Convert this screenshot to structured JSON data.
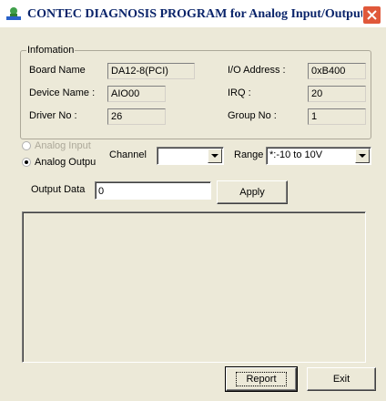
{
  "window": {
    "title": "CONTEC DIAGNOSIS PROGRAM for Analog Input/Output"
  },
  "info": {
    "group_label": "Infomation",
    "board_name_label": "Board Name",
    "board_name_value": "DA12-8(PCI)",
    "io_address_label": "I/O Address :",
    "io_address_value": "0xB400",
    "device_name_label": "Device Name :",
    "device_name_value": "AIO00",
    "irq_label": "IRQ :",
    "irq_value": "20",
    "driver_no_label": "Driver No :",
    "driver_no_value": "26",
    "group_no_label": "Group No :",
    "group_no_value": "1"
  },
  "mode": {
    "analog_input_label": "Analog Input",
    "analog_output_label": "Analog Outpu",
    "selected": "analog_output"
  },
  "channel": {
    "label": "Channel",
    "value": ""
  },
  "range": {
    "label": "Range",
    "value": "*:-10 to 10V"
  },
  "output_data": {
    "label": "Output Data",
    "value": "0"
  },
  "buttons": {
    "apply": "Apply",
    "report": "Report",
    "exit": "Exit"
  }
}
